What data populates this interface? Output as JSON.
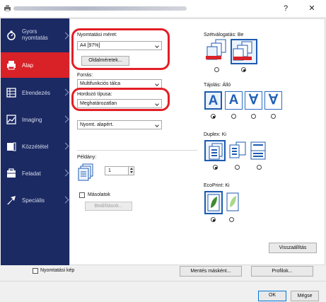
{
  "window": {
    "title_blurred": "Printing Preferences",
    "help_glyph": "?",
    "close_glyph": "✕"
  },
  "sidebar": {
    "items": [
      {
        "label": "Gyors nyomtatás",
        "icon": "quick-print-icon"
      },
      {
        "label": "Alap",
        "icon": "printer-icon",
        "active": true
      },
      {
        "label": "Elrendezés",
        "icon": "layout-icon"
      },
      {
        "label": "Imaging",
        "icon": "imaging-icon"
      },
      {
        "label": "Közzététel",
        "icon": "publishing-icon"
      },
      {
        "label": "Feladat",
        "icon": "job-icon"
      },
      {
        "label": "Speciális",
        "icon": "advanced-icon"
      }
    ]
  },
  "basic": {
    "print_size_label": "Nyomtatási méret:",
    "print_size_value": "A4  [97%]",
    "page_sizes_button": "Oldalméretek...",
    "source_label": "Forrás:",
    "source_value": "Multifunkciós tálca",
    "media_type_label": "Hordozó típusa:",
    "media_type_value": "Meghatározatlan",
    "third_combo_value": "Nyomt. alapért.",
    "copies_label": "Példány:",
    "copies_value": "1",
    "copies_checkbox_label": "Másolatok",
    "settings_button": "Beállítások..."
  },
  "right": {
    "collate_label": "Szétválogatás:",
    "collate_value": "Be",
    "orientation_label": "Tájolás:",
    "orientation_value": "Álló",
    "orientation_glyphs": [
      "A",
      "A",
      "∀",
      "∀"
    ],
    "duplex_label": "Duplex:",
    "duplex_value": "Ki",
    "ecoprint_label": "EcoPrint:",
    "ecoprint_value": "Ki",
    "reset_button": "Visszaállítás"
  },
  "footer": {
    "print_preview_label": "Nyomtatási kép",
    "save_as_button": "Mentés másként...",
    "profiles_button": "Profilok...",
    "ok_button": "OK",
    "cancel_button": "Mégse"
  },
  "colors": {
    "sidebar_bg": "#1b2a63",
    "active_item": "#d92128",
    "highlight_ring": "#e31e26",
    "accent_blue": "#1d5bb0"
  }
}
